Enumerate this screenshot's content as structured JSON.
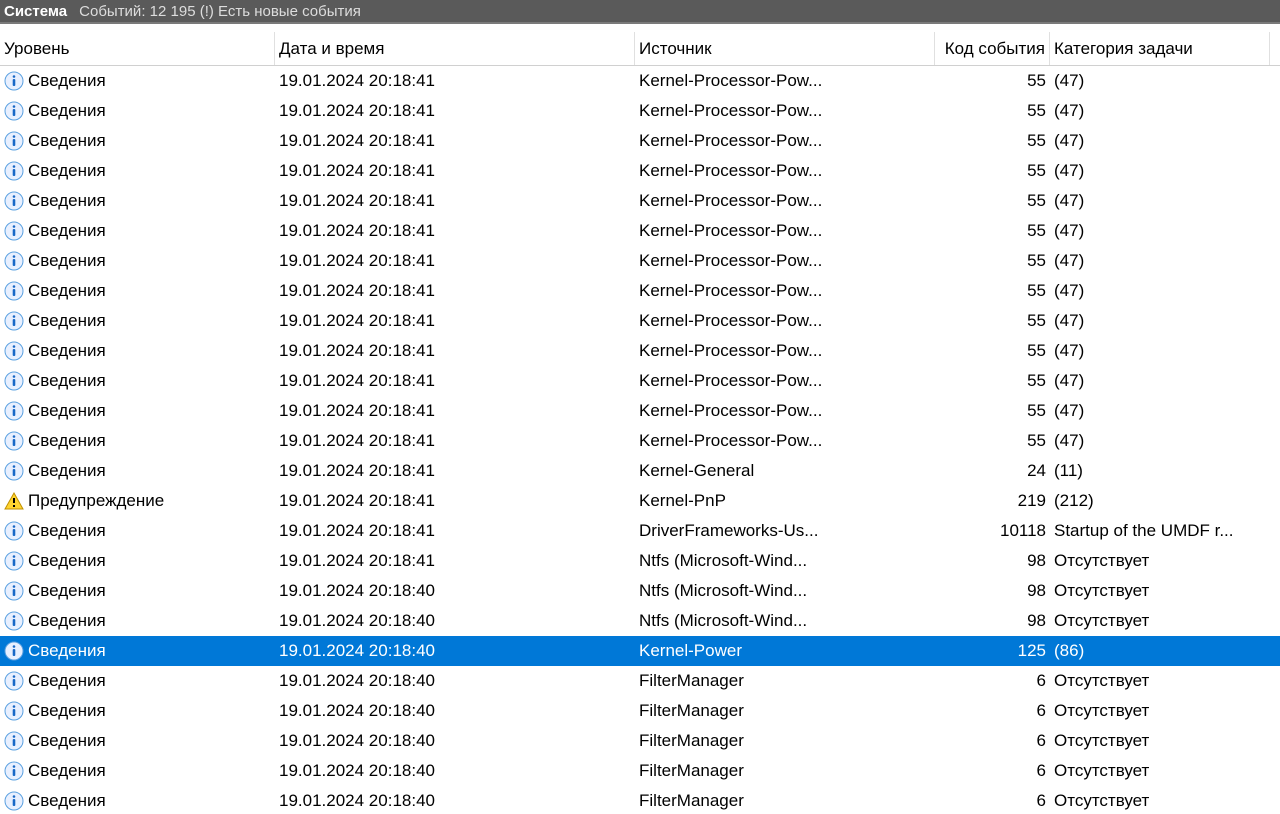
{
  "titlebar": {
    "main": "Система",
    "status": "Событий: 12 195 (!) Есть новые события"
  },
  "columns": {
    "level": "Уровень",
    "datetime": "Дата и время",
    "source": "Источник",
    "event_code": "Код события",
    "task_category": "Категория задачи"
  },
  "icons": {
    "info": "info-icon",
    "warn": "warning-icon"
  },
  "events": [
    {
      "icon": "info",
      "level": "Сведения",
      "datetime": "19.01.2024 20:18:41",
      "source": "Kernel-Processor-Pow...",
      "code": "55",
      "category": "(47)",
      "selected": false
    },
    {
      "icon": "info",
      "level": "Сведения",
      "datetime": "19.01.2024 20:18:41",
      "source": "Kernel-Processor-Pow...",
      "code": "55",
      "category": "(47)",
      "selected": false
    },
    {
      "icon": "info",
      "level": "Сведения",
      "datetime": "19.01.2024 20:18:41",
      "source": "Kernel-Processor-Pow...",
      "code": "55",
      "category": "(47)",
      "selected": false
    },
    {
      "icon": "info",
      "level": "Сведения",
      "datetime": "19.01.2024 20:18:41",
      "source": "Kernel-Processor-Pow...",
      "code": "55",
      "category": "(47)",
      "selected": false
    },
    {
      "icon": "info",
      "level": "Сведения",
      "datetime": "19.01.2024 20:18:41",
      "source": "Kernel-Processor-Pow...",
      "code": "55",
      "category": "(47)",
      "selected": false
    },
    {
      "icon": "info",
      "level": "Сведения",
      "datetime": "19.01.2024 20:18:41",
      "source": "Kernel-Processor-Pow...",
      "code": "55",
      "category": "(47)",
      "selected": false
    },
    {
      "icon": "info",
      "level": "Сведения",
      "datetime": "19.01.2024 20:18:41",
      "source": "Kernel-Processor-Pow...",
      "code": "55",
      "category": "(47)",
      "selected": false
    },
    {
      "icon": "info",
      "level": "Сведения",
      "datetime": "19.01.2024 20:18:41",
      "source": "Kernel-Processor-Pow...",
      "code": "55",
      "category": "(47)",
      "selected": false
    },
    {
      "icon": "info",
      "level": "Сведения",
      "datetime": "19.01.2024 20:18:41",
      "source": "Kernel-Processor-Pow...",
      "code": "55",
      "category": "(47)",
      "selected": false
    },
    {
      "icon": "info",
      "level": "Сведения",
      "datetime": "19.01.2024 20:18:41",
      "source": "Kernel-Processor-Pow...",
      "code": "55",
      "category": "(47)",
      "selected": false
    },
    {
      "icon": "info",
      "level": "Сведения",
      "datetime": "19.01.2024 20:18:41",
      "source": "Kernel-Processor-Pow...",
      "code": "55",
      "category": "(47)",
      "selected": false
    },
    {
      "icon": "info",
      "level": "Сведения",
      "datetime": "19.01.2024 20:18:41",
      "source": "Kernel-Processor-Pow...",
      "code": "55",
      "category": "(47)",
      "selected": false
    },
    {
      "icon": "info",
      "level": "Сведения",
      "datetime": "19.01.2024 20:18:41",
      "source": "Kernel-Processor-Pow...",
      "code": "55",
      "category": "(47)",
      "selected": false
    },
    {
      "icon": "info",
      "level": "Сведения",
      "datetime": "19.01.2024 20:18:41",
      "source": "Kernel-General",
      "code": "24",
      "category": "(11)",
      "selected": false
    },
    {
      "icon": "warn",
      "level": "Предупреждение",
      "datetime": "19.01.2024 20:18:41",
      "source": "Kernel-PnP",
      "code": "219",
      "category": "(212)",
      "selected": false
    },
    {
      "icon": "info",
      "level": "Сведения",
      "datetime": "19.01.2024 20:18:41",
      "source": "DriverFrameworks-Us...",
      "code": "10118",
      "category": "Startup of the UMDF r...",
      "selected": false
    },
    {
      "icon": "info",
      "level": "Сведения",
      "datetime": "19.01.2024 20:18:41",
      "source": "Ntfs (Microsoft-Wind...",
      "code": "98",
      "category": "Отсутствует",
      "selected": false
    },
    {
      "icon": "info",
      "level": "Сведения",
      "datetime": "19.01.2024 20:18:40",
      "source": "Ntfs (Microsoft-Wind...",
      "code": "98",
      "category": "Отсутствует",
      "selected": false
    },
    {
      "icon": "info",
      "level": "Сведения",
      "datetime": "19.01.2024 20:18:40",
      "source": "Ntfs (Microsoft-Wind...",
      "code": "98",
      "category": "Отсутствует",
      "selected": false
    },
    {
      "icon": "info",
      "level": "Сведения",
      "datetime": "19.01.2024 20:18:40",
      "source": "Kernel-Power",
      "code": "125",
      "category": "(86)",
      "selected": true
    },
    {
      "icon": "info",
      "level": "Сведения",
      "datetime": "19.01.2024 20:18:40",
      "source": "FilterManager",
      "code": "6",
      "category": "Отсутствует",
      "selected": false
    },
    {
      "icon": "info",
      "level": "Сведения",
      "datetime": "19.01.2024 20:18:40",
      "source": "FilterManager",
      "code": "6",
      "category": "Отсутствует",
      "selected": false
    },
    {
      "icon": "info",
      "level": "Сведения",
      "datetime": "19.01.2024 20:18:40",
      "source": "FilterManager",
      "code": "6",
      "category": "Отсутствует",
      "selected": false
    },
    {
      "icon": "info",
      "level": "Сведения",
      "datetime": "19.01.2024 20:18:40",
      "source": "FilterManager",
      "code": "6",
      "category": "Отсутствует",
      "selected": false
    },
    {
      "icon": "info",
      "level": "Сведения",
      "datetime": "19.01.2024 20:18:40",
      "source": "FilterManager",
      "code": "6",
      "category": "Отсутствует",
      "selected": false
    }
  ]
}
